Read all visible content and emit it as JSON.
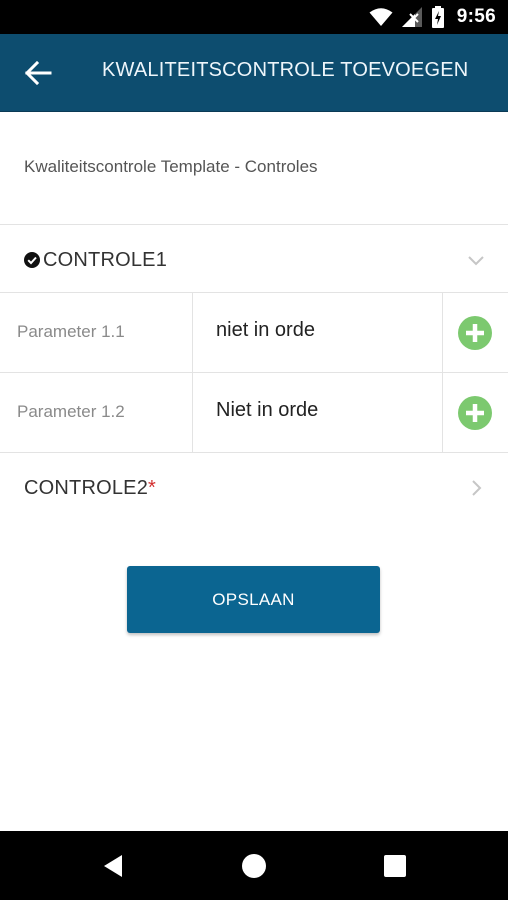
{
  "status_bar": {
    "time": "9:56",
    "icons": [
      "wifi-icon",
      "signal-icon",
      "battery-icon"
    ]
  },
  "app_bar": {
    "title": "KWALITEITSCONTROLE TOEVOEGEN",
    "back_icon": "arrow-left-icon",
    "background": "#0d4d6f"
  },
  "subtitle": "Kwaliteitscontrole Template - Controles",
  "sections": [
    {
      "label": "CONTROLE1",
      "required_mark": "",
      "completed": true,
      "expanded": true,
      "parameters": [
        {
          "name": "Parameter 1.1",
          "value": "niet in orde"
        },
        {
          "name": "Parameter 1.2",
          "value": "Niet in orde"
        }
      ]
    },
    {
      "label": "CONTROLE2",
      "required_mark": "*",
      "completed": false,
      "expanded": false,
      "parameters": []
    }
  ],
  "save_button": {
    "label": "OPSLAAN",
    "color": "#0b6591"
  },
  "colors": {
    "add_icon": "#7cc96f",
    "required": "#d32f2f"
  },
  "nav_bar": {
    "icons": [
      "back-triangle-icon",
      "home-circle-icon",
      "recents-square-icon"
    ]
  }
}
